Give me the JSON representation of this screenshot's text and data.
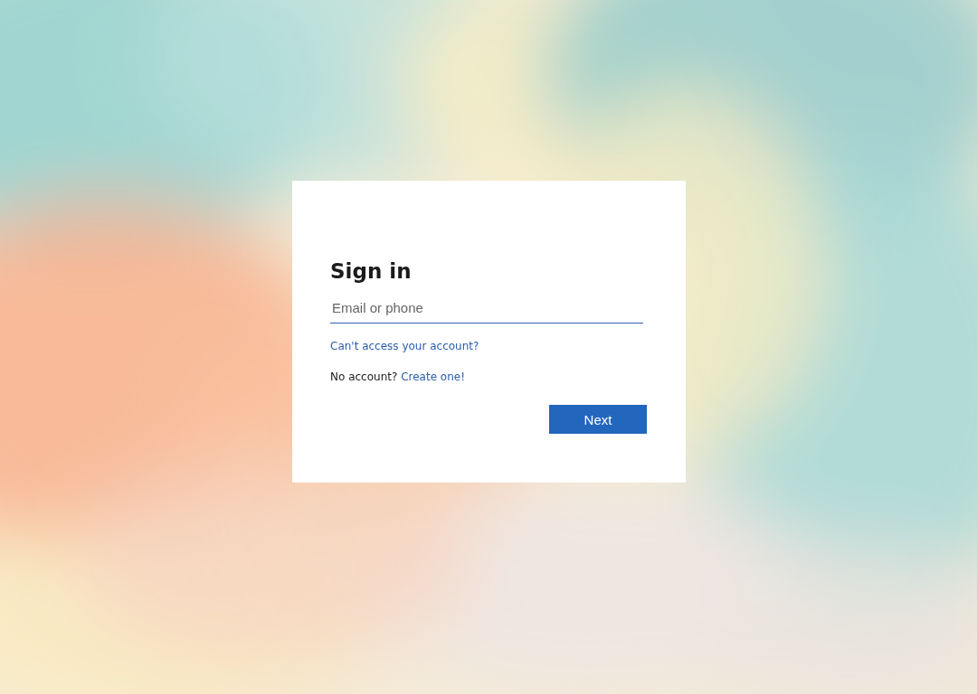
{
  "card": {
    "title": "Sign in",
    "email_field": {
      "placeholder": "Email or phone"
    },
    "recover_link": "Can't access your account?",
    "signup": {
      "prompt": "No account?",
      "link": "Create one!"
    },
    "next_button": "Next"
  }
}
